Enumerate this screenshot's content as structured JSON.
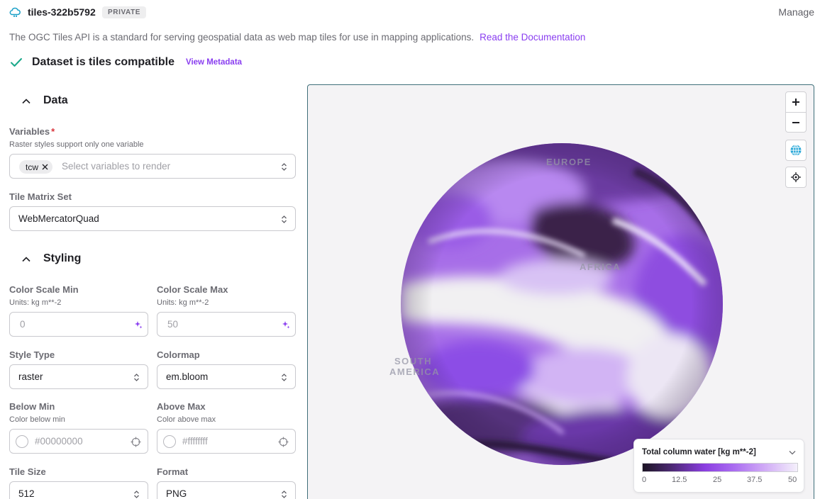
{
  "header": {
    "repo_name": "tiles-322b5792",
    "badge": "PRIVATE",
    "manage_label": "Manage"
  },
  "description": {
    "text": "The OGC Tiles API is a standard for serving geospatial data as web map tiles for use in mapping applications.",
    "link": "Read the Documentation"
  },
  "compat": {
    "text": "Dataset is tiles compatible",
    "link": "View Metadata"
  },
  "data_section": {
    "title": "Data",
    "variables": {
      "label": "Variables",
      "required_mark": "*",
      "help": "Raster styles support only one variable",
      "chip": "tcw",
      "placeholder": "Select variables to render"
    },
    "tile_matrix_set": {
      "label": "Tile Matrix Set",
      "value": "WebMercatorQuad"
    }
  },
  "styling_section": {
    "title": "Styling",
    "color_scale_min": {
      "label": "Color Scale Min",
      "units": "Units: kg m**-2",
      "placeholder": "0"
    },
    "color_scale_max": {
      "label": "Color Scale Max",
      "units": "Units: kg m**-2",
      "placeholder": "50"
    },
    "style_type": {
      "label": "Style Type",
      "value": "raster"
    },
    "colormap": {
      "label": "Colormap",
      "value": "em.bloom"
    },
    "below_min": {
      "label": "Below Min",
      "help": "Color below min",
      "placeholder": "#00000000"
    },
    "above_max": {
      "label": "Above Max",
      "help": "Color above max",
      "placeholder": "#ffffffff"
    },
    "tile_size": {
      "label": "Tile Size",
      "value": "512"
    },
    "format": {
      "label": "Format",
      "value": "PNG"
    }
  },
  "map": {
    "labels": {
      "europe": "EUROPE",
      "africa": "AFRICA",
      "south": "SOUTH",
      "america": "AMERICA"
    },
    "legend": {
      "title": "Total column water [kg m**-2]",
      "ticks": [
        "0",
        "12.5",
        "25",
        "37.5",
        "50"
      ]
    }
  },
  "icons": {
    "logo": "cloud-tiles-icon",
    "compat": "check-icon",
    "section_toggle": "chevron-up-icon",
    "chip_remove": "close-icon",
    "select": "up-down-chevron-icon",
    "ai_fill": "sparkle-icon",
    "color_swatch": "empty-circle-icon",
    "eyedropper": "crosshair-icon",
    "zoom_in": "plus-icon",
    "zoom_out": "minus-icon",
    "projection": "globe-icon",
    "locate": "locate-icon",
    "legend_toggle": "chevron-down-icon"
  },
  "colors": {
    "accent": "#8a3ef0",
    "check": "#1aa88a",
    "required": "#d9343b",
    "text": "#1f1f24",
    "muted": "#6b6b72"
  }
}
